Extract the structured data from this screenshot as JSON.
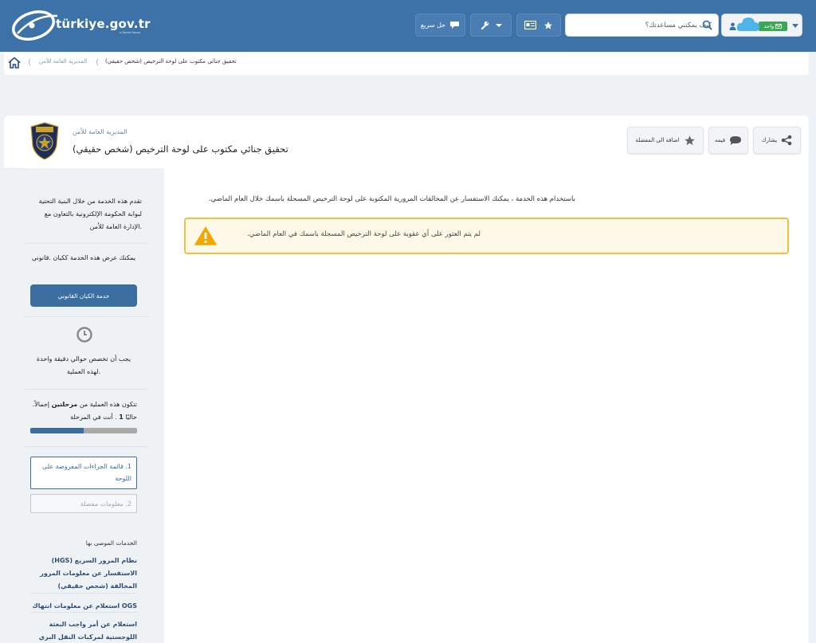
{
  "header": {
    "logo_text": "türkiye.gov.tr",
    "logo_tagline": "e-Devlet Kapısı",
    "quick_solution": "حل سريع",
    "search_placeholder": "كيف يمكنني مساعدتك؟",
    "login_badge": "واحد"
  },
  "breadcrumb": {
    "items": [
      "المديرية العامة للأمن",
      "تحقيق جنائي مكتوب على لوحة الترخيص (شخص حقيقي)"
    ]
  },
  "title_panel": {
    "organization": "المديرية العامة للأمن",
    "title": "تحقيق جنائي مكتوب على لوحة الترخيص (شخص حقيقي)",
    "share_label": "يشارك",
    "comment_label": "فيمه",
    "favorite_label": "اضافة الى المفضلة"
  },
  "sidebar": {
    "provider_text": "تقدم هذه الخدمة من خلال البنية التحتية لبوابة الحكومة الإلكترونية بالتعاون مع .الإدارة العامة للأمن",
    "legal_text": "يمكنك عرض هذه الخدمة ككيان .قانوني",
    "legal_button": "خدمة الكيان القانوني",
    "time_text": "يجب أن تخصص حوالي دقيقة واحدة .لهذه العملية",
    "stages_prefix": "تتكون هذه العملية من",
    "stages_bold": "مرحلتين",
    "stages_suffix": "إجمالاً. حاليًا",
    "stage_current": "1",
    "stages_end": ". أنت في المرحلة",
    "progress": 0.5,
    "steps": [
      {
        "label": "1. قائمة الجزاءات المفروضة على اللوحة"
      },
      {
        "label": "2. معلومات مفصلة"
      }
    ],
    "recommended_title": "الخدمات الموصى بها",
    "recommended": [
      "نظام المرور السريع (HGS) الاستفسار عن معلومات المرور المخالفة (شخص حقيقي)",
      "OGS استعلام عن معلومات انتهاك",
      "استعلام عن أمر واجب البعثة اللوجستية لمركبات النقل البري"
    ]
  },
  "main": {
    "intro": "باستخدام هذه الخدمة ، يمكنك الاستفسار عن المخالفات المرورية المكتوبة على لوحة الترخيص المسجلة باسمك خلال العام الماضي.",
    "alert": "لم يتم العثور على أي عقوبة على لوحة الترخيص المسجلة باسمك في العام الماضي."
  },
  "colors": {
    "header_bg": "#3d72a8",
    "primary": "#3b6e9f",
    "alert_border": "#f0c040",
    "alert_bg": "#fdf8e8",
    "login_badge": "#3aa854",
    "cloud": "#4fb3e8"
  },
  "icons": [
    "comment-icon",
    "wrench-icon",
    "id-card-icon",
    "star-icon",
    "search-icon",
    "user-icon",
    "cloud-icon",
    "home-icon",
    "share-icon",
    "warning-icon",
    "clock-icon",
    "police-emblem-icon"
  ]
}
